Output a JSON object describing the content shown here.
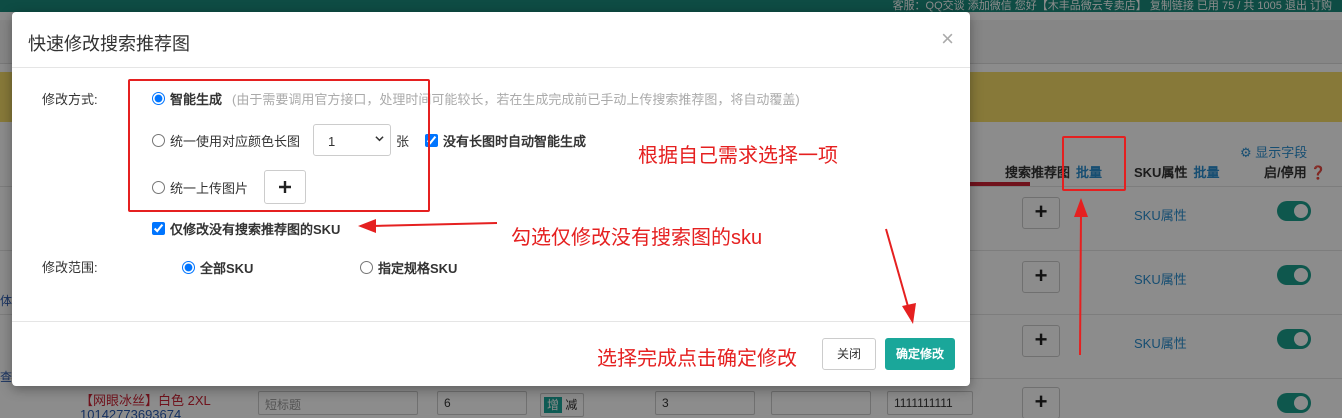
{
  "background": {
    "topbar_text": "客服：QQ交谈  添加微信  您好【木丰品微云专卖店】  复制链接  已用 75 / 共 1005  退出  订购",
    "show_fields": "显示字段",
    "table_headers": {
      "search_image": "搜索推荐图",
      "batch": "批量",
      "sku_attr": "SKU属性",
      "sku_batch": "批量",
      "enable": "启/停用"
    },
    "row_sku_label": "SKU属性",
    "left_cut_1": "体",
    "left_cut_2": "查",
    "bottom_row": {
      "product": "【网眼冰丝】白色 2XL",
      "product_id": "10142773693674",
      "short_title_placeholder": "短标题",
      "qty": "6",
      "inc": "增",
      "dec": "减",
      "qty2": "3",
      "code": "1111111111"
    }
  },
  "modal": {
    "title": "快速修改搜索推荐图",
    "close_icon": "×",
    "method_label": "修改方式:",
    "options": {
      "smart_label": "智能生成",
      "smart_hint": "(由于需要调用官方接口，处理时间可能较长，若在生成完成前已手动上传搜索推荐图，将自动覆盖)",
      "color_long_label": "统一使用对应颜色长图",
      "select_value": "1",
      "unit": "张",
      "auto_smart_label": "没有长图时自动智能生成",
      "upload_label": "统一上传图片"
    },
    "only_no_sku_label": "仅修改没有搜索推荐图的SKU",
    "range_label": "修改范围:",
    "range_options": {
      "all_label": "全部SKU",
      "specified_label": "指定规格SKU"
    },
    "buttons": {
      "close": "关闭",
      "confirm": "确定修改"
    }
  },
  "annotations": {
    "choose_one": "根据自己需求选择一项",
    "check_only": "勾选仅修改没有搜索图的sku",
    "confirm_hint": "选择完成点击确定修改"
  },
  "colors": {
    "accent": "#1aa79a",
    "annotation": "#e52020"
  }
}
